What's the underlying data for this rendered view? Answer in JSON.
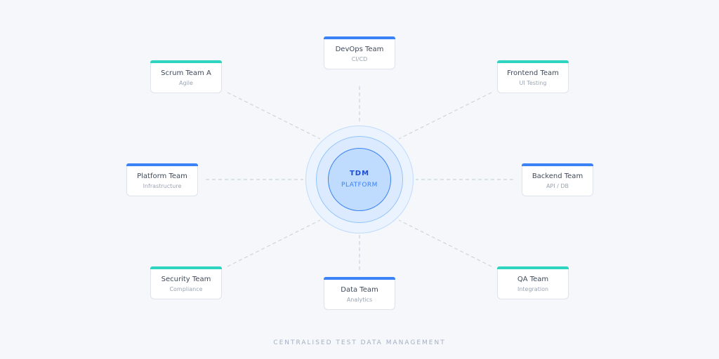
{
  "hub": {
    "title": "TDM",
    "subtitle": "PLATFORM"
  },
  "caption": "CENTRALISED TEST DATA MANAGEMENT",
  "colors": {
    "blue_accent": "#3b82f6",
    "teal_accent": "#2dd4bf",
    "connector": "#cbd5e1"
  },
  "teams": [
    {
      "name": "DevOps Team",
      "detail": "CI/CD",
      "accent": "blue"
    },
    {
      "name": "Frontend Team",
      "detail": "UI Testing",
      "accent": "teal"
    },
    {
      "name": "Backend Team",
      "detail": "API / DB",
      "accent": "blue"
    },
    {
      "name": "QA Team",
      "detail": "Integration",
      "accent": "teal"
    },
    {
      "name": "Data Team",
      "detail": "Analytics",
      "accent": "blue"
    },
    {
      "name": "Security Team",
      "detail": "Compliance",
      "accent": "teal"
    },
    {
      "name": "Platform Team",
      "detail": "Infrastructure",
      "accent": "blue"
    },
    {
      "name": "Scrum Team A",
      "detail": "Agile",
      "accent": "teal"
    }
  ]
}
